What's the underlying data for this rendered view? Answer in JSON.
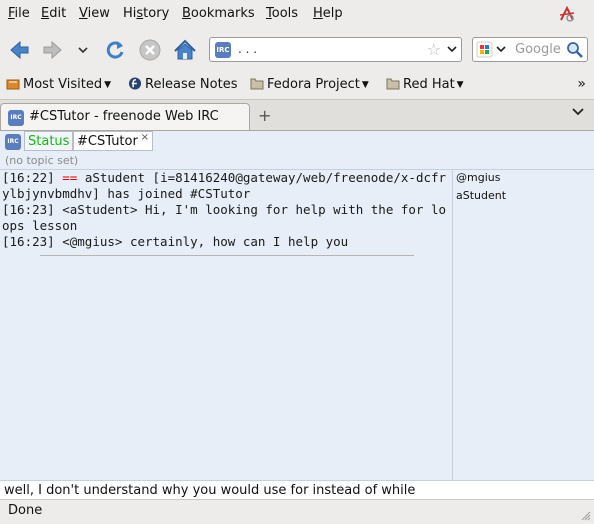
{
  "menubar": {
    "items": [
      {
        "label": "File",
        "u": "F",
        "rest": "ile"
      },
      {
        "label": "Edit",
        "u": "E",
        "rest": "dit"
      },
      {
        "label": "View",
        "u": "V",
        "rest": "iew"
      },
      {
        "label": "History",
        "u": "s",
        "pre": "Hi",
        "rest": "tory"
      },
      {
        "label": "Bookmarks",
        "u": "B",
        "rest": "ookmarks"
      },
      {
        "label": "Tools",
        "u": "T",
        "rest": "ools"
      },
      {
        "label": "Help",
        "u": "H",
        "rest": "elp"
      }
    ]
  },
  "navbar": {
    "url": ".      .    .",
    "search_placeholder": "Google"
  },
  "bookmarks": {
    "items": [
      {
        "label": "Most Visited"
      },
      {
        "label": "Release Notes"
      },
      {
        "label": "Fedora Project"
      },
      {
        "label": "Red Hat"
      }
    ],
    "more": "»"
  },
  "tab": {
    "title": "#CSTutor - freenode Web IRC",
    "newtab": "+"
  },
  "irc": {
    "status_tab": "Status",
    "channel_tab": "#CSTutor",
    "close": "×",
    "topic": "(no topic set)",
    "lines": [
      {
        "time": "[16:22]",
        "marker": "==",
        "text": "aStudent [i=81416240@gateway/web/freenode/x-dcfrylbjynvbmdhv] has joined #CSTutor"
      },
      {
        "time": "[16:23]",
        "marker": "",
        "text": "<aStudent> Hi, I'm looking for help with the for loops lesson"
      },
      {
        "time": "[16:23]",
        "marker": "",
        "text": "<@mgius> certainly, how can I help you"
      }
    ],
    "nicks": [
      "@mgius",
      "aStudent"
    ],
    "input_value": "well, I don't understand why you would use for instead of while"
  },
  "status": {
    "text": "Done"
  },
  "colors": {
    "status_tab_green": "#19b41c",
    "join_marker_red": "#d10000",
    "content_bg": "#e7eef7"
  }
}
